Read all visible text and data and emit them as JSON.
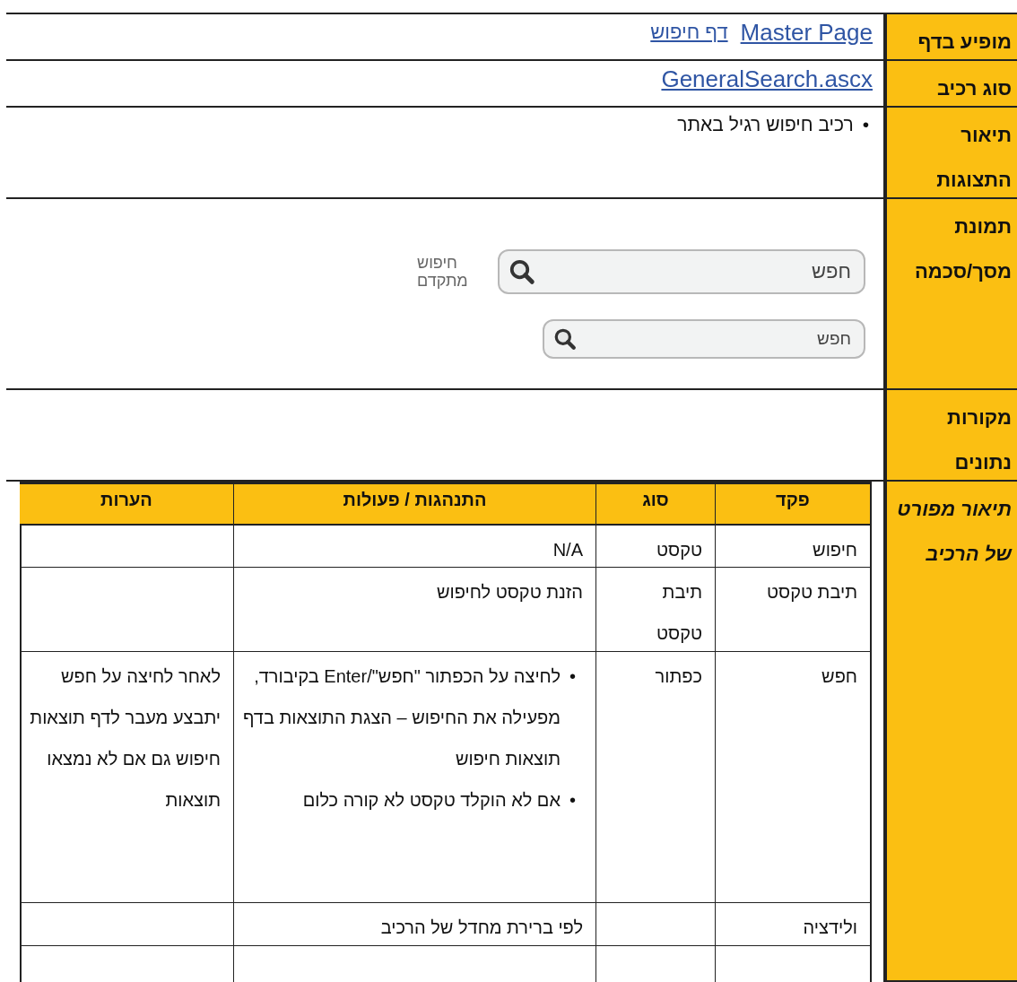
{
  "rows": [
    {
      "label": "מופיע בדף",
      "kind": "links",
      "links": [
        "Master Page",
        "דף חיפוש"
      ]
    },
    {
      "label": "סוג רכיב",
      "kind": "links",
      "links": [
        "GeneralSearch.ascx"
      ]
    },
    {
      "label": "תיאור התצוגות",
      "kind": "bullets",
      "marker": "•",
      "bullets": [
        "רכיב חיפוש רגיל באתר"
      ]
    },
    {
      "label": "תמונת מסך/סכמה",
      "kind": "mockup",
      "fields": [
        {
          "placeholder": "חפש",
          "side_link": "חיפוש מתקדם"
        },
        {
          "placeholder": "חפש"
        }
      ]
    },
    {
      "label": "מקורות נתונים",
      "kind": "empty"
    },
    {
      "label": "תיאור מפורט של הרכיב",
      "kind": "table",
      "marker": "•",
      "columns": [
        "פקד",
        "סוג",
        "התנהגות / פעולות",
        "הערות"
      ],
      "table_rows": [
        {
          "control": "חיפוש",
          "type": "טקסט",
          "behavior": "N/A"
        },
        {
          "control": "תיבת טקסט",
          "type": "תיבת טקסט",
          "behavior": "הזנת טקסט לחיפוש"
        },
        {
          "control": "חפש",
          "type": "כפתור",
          "behavior_bullets": [
            "לחיצה על הכפתור \"חפש\"/Enter בקיבורד, מפעילה את החיפוש – הצגת התוצאות בדף תוצאות חיפוש",
            "אם לא הוקלד טקסט לא קורה כלום"
          ],
          "notes": "לאחר לחיצה על חפש יתבצע מעבר לדף תוצאות חיפוש גם אם לא נמצאו תוצאות"
        },
        {
          "control": "ולידציה",
          "behavior": "לפי ברירת מחדל של הרכיב"
        }
      ]
    }
  ]
}
